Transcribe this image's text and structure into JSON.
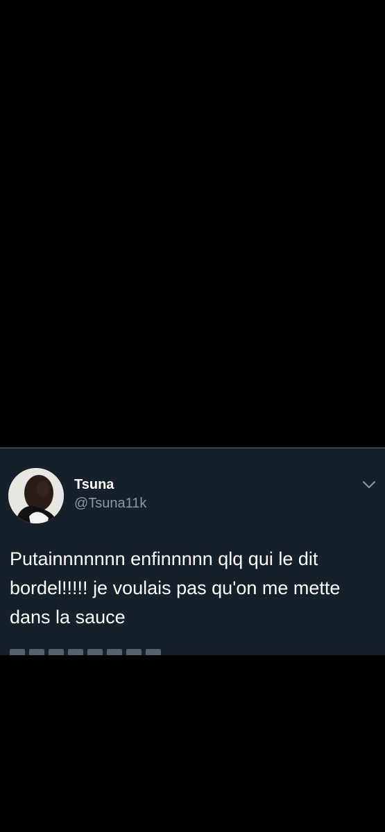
{
  "tweet": {
    "display_name": "Tsuna",
    "handle": "@Tsuna11k",
    "text": "Putainnnnnnn enfinnnnn qlq qui le dit bordel!!!!! je voulais pas qu'on me mette dans la sauce"
  },
  "icons": {
    "avatar": "profile-photo",
    "menu": "chevron-down-icon"
  },
  "colors": {
    "background": "#000000",
    "card": "#15202b",
    "divider": "#38444d",
    "primary_text": "#ffffff",
    "secondary_text": "#8899a6"
  }
}
